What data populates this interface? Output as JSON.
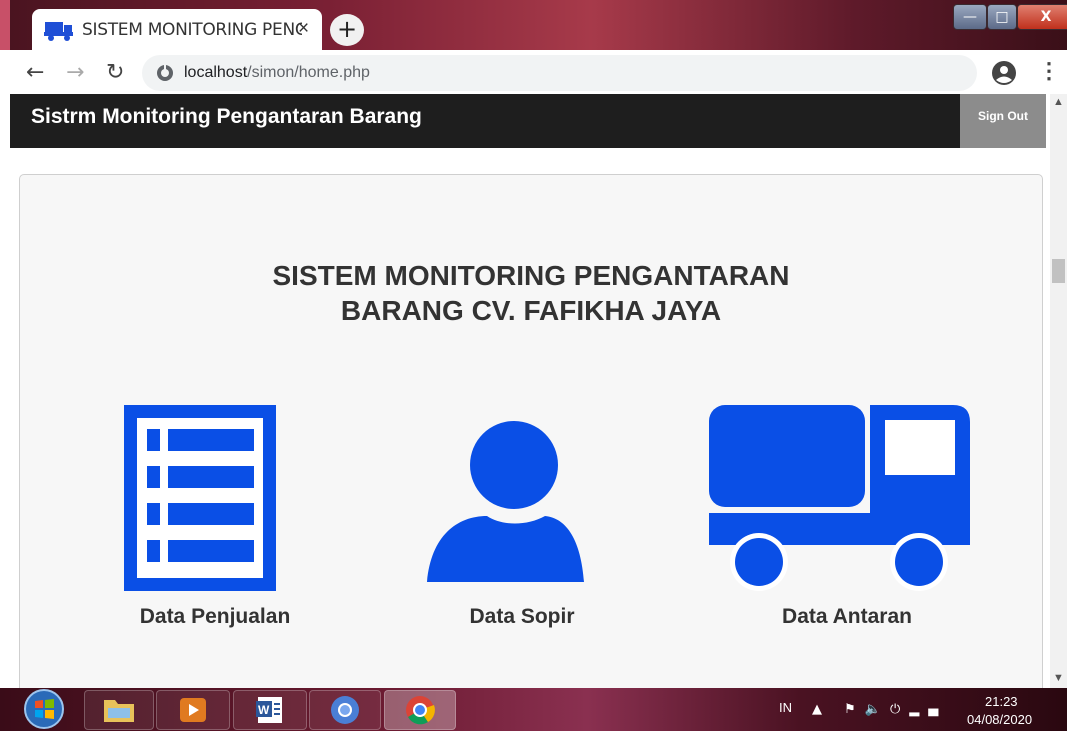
{
  "browser": {
    "tab_title": "SISTEM MONITORING PENGANTARAN BARANG",
    "tab_close": "×",
    "new_tab": "+",
    "url_host": "localhost",
    "url_path": "/simon/home.php",
    "icons": [
      "truck-favicon",
      "back-arrow-icon",
      "forward-arrow-icon",
      "reload-icon",
      "site-info-icon",
      "profile-icon",
      "kebab-menu-icon"
    ]
  },
  "window_controls": {
    "minimize": "—",
    "maximize": "□",
    "close": "X"
  },
  "navbar": {
    "brand": "Sistrm Monitoring Pengantaran Barang",
    "sign_out": "Sign Out"
  },
  "main": {
    "headline_line1": "SISTEM MONITORING PENGANTARAN",
    "headline_line2": "BARANG CV. FAFIKHA JAYA",
    "menu": [
      {
        "label": "Data Penjualan",
        "icon": "list-document-icon"
      },
      {
        "label": "Data Sopir",
        "icon": "person-icon"
      },
      {
        "label": "Data Antaran",
        "icon": "truck-icon"
      }
    ]
  },
  "taskbar": {
    "apps": [
      "windows-start",
      "file-explorer",
      "media-player",
      "word",
      "chromium",
      "chrome"
    ],
    "language": "IN",
    "time": "21:23",
    "date": "04/08/2020"
  },
  "colors": {
    "accent_blue": "#0a4fe6",
    "navbar_bg": "#1e1e1e",
    "signout_bg": "#8c8c8c",
    "panel_bg": "#f7f7f7",
    "heading_text": "#333333"
  }
}
